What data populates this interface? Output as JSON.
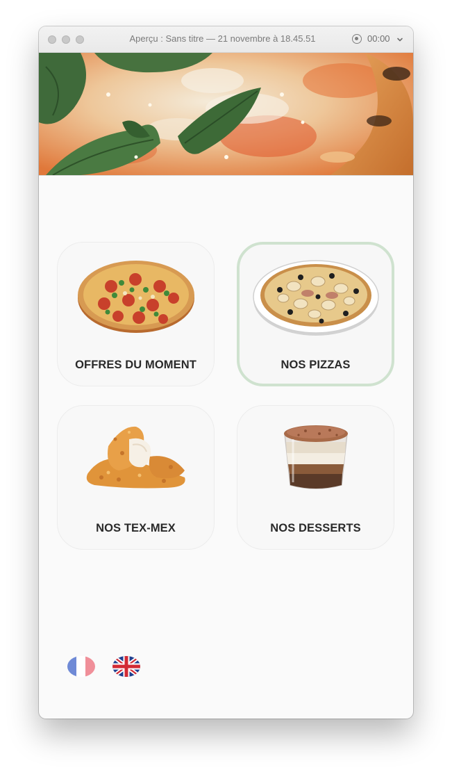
{
  "window": {
    "title": "Aperçu : Sans titre — 21 novembre à 18.45.51",
    "timer": "00:00"
  },
  "icons": {
    "record": "record-icon",
    "chevron": "chevron-down-icon"
  },
  "hero": {
    "image": "pizza-banner-image"
  },
  "categories": [
    {
      "label": "OFFRES DU MOMENT",
      "image": "pepperoni-pizza-image",
      "selected": false
    },
    {
      "label": "NOS PIZZAS",
      "image": "mushroom-pizza-image",
      "selected": true
    },
    {
      "label": "NOS TEX-MEX",
      "image": "chicken-tenders-image",
      "selected": false
    },
    {
      "label": "NOS DESSERTS",
      "image": "tiramisu-cup-image",
      "selected": false
    }
  ],
  "languages": [
    {
      "code": "fr",
      "icon": "french-flag-icon"
    },
    {
      "code": "en",
      "icon": "uk-flag-icon"
    }
  ],
  "colors": {
    "selected_border": "#cfe2cf",
    "tile_background": "#f8f8f8",
    "label_text": "#2a2a2a"
  }
}
